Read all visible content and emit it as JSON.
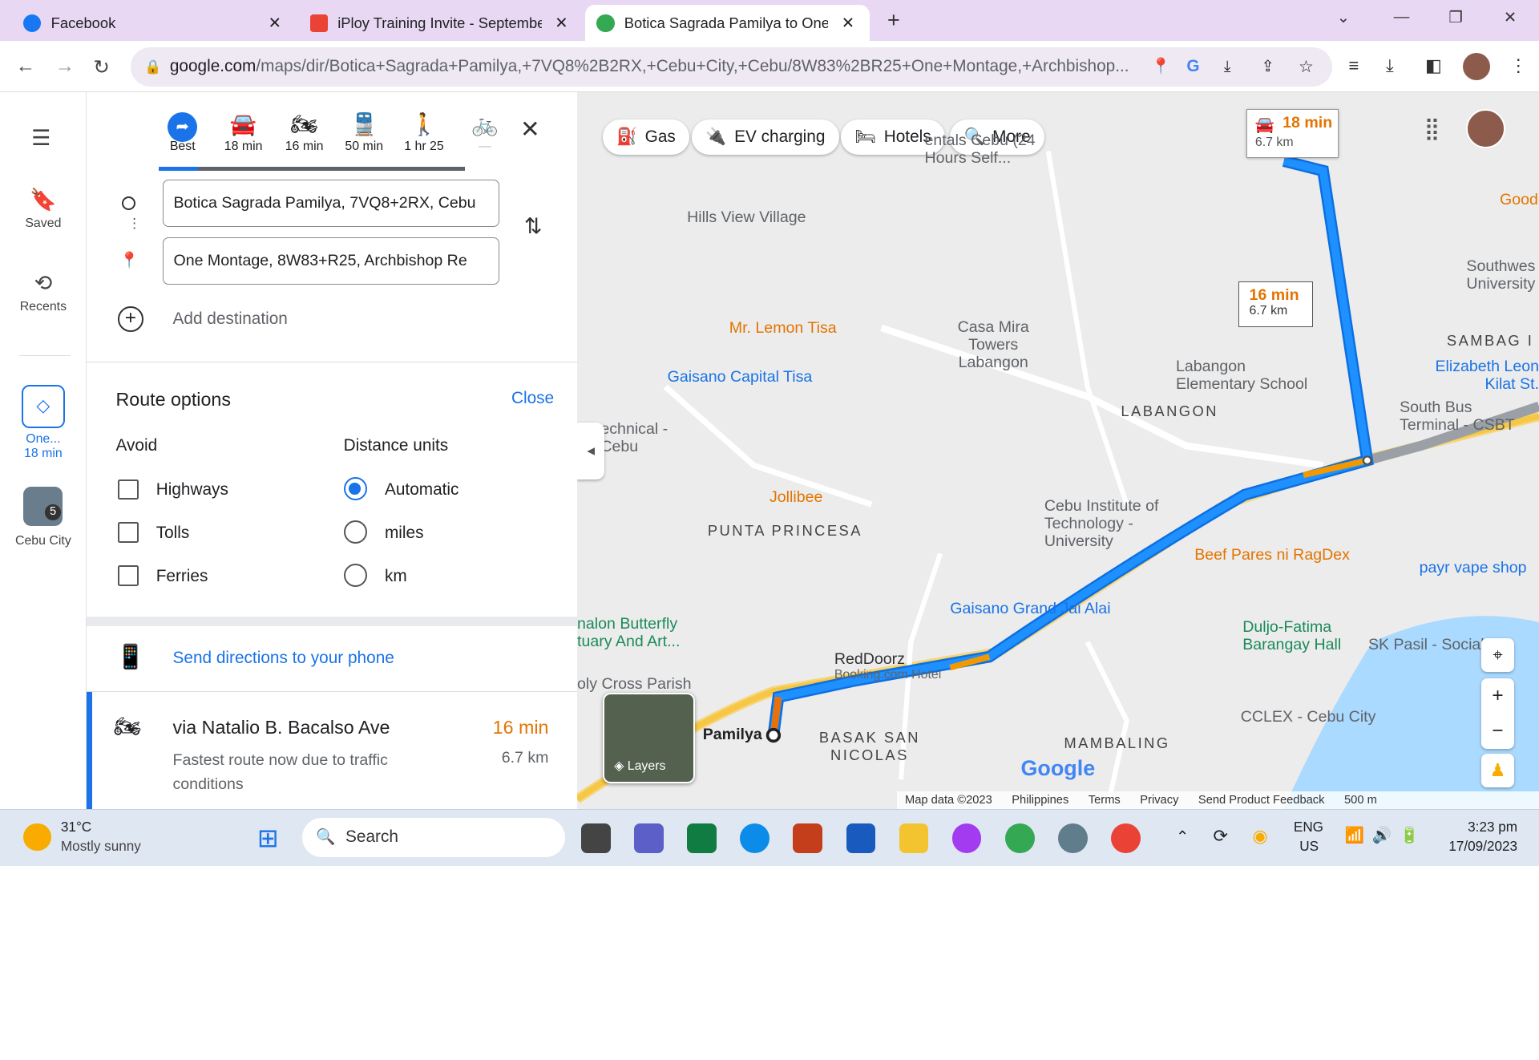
{
  "browser": {
    "tabs": [
      {
        "title": "Facebook",
        "color": "#1877f2"
      },
      {
        "title": "iPloy Training Invite - September",
        "color": "#ea4335"
      },
      {
        "title": "Botica Sagrada Pamilya to One M",
        "color": "#34a853"
      }
    ],
    "url_main": "google.com",
    "url_path": "/maps/dir/Botica+Sagrada+Pamilya,+7VQ8%2B2RX,+Cebu+City,+Cebu/8W83%2BR25+One+Montage,+Archbishop..."
  },
  "rail": {
    "saved": "Saved",
    "recents": "Recents",
    "recent_route_label": "One...",
    "recent_route_time": "18 min",
    "city_label": "Cebu City",
    "city_badge": "5"
  },
  "modes": [
    {
      "label": "Best",
      "icon": "diamond-route-icon"
    },
    {
      "label": "18 min",
      "icon": "car-icon"
    },
    {
      "label": "16 min",
      "icon": "motorcycle-icon"
    },
    {
      "label": "50 min",
      "icon": "train-icon"
    },
    {
      "label": "1 hr 25",
      "icon": "walk-icon"
    },
    {
      "label": "—",
      "icon": "bicycle-icon"
    }
  ],
  "directions": {
    "origin": "Botica Sagrada Pamilya, 7VQ8+2RX, Cebu",
    "destination": "One Montage, 8W83+R25, Archbishop Re",
    "add_destination": "Add destination"
  },
  "route_options": {
    "title": "Route options",
    "close": "Close",
    "avoid_title": "Avoid",
    "avoid": [
      "Highways",
      "Tolls",
      "Ferries"
    ],
    "units_title": "Distance units",
    "units": [
      "Automatic",
      "miles",
      "km"
    ],
    "units_selected": "Automatic"
  },
  "send": "Send directions to your phone",
  "route": {
    "via": "via Natalio B. Bacalso Ave",
    "time": "16 min",
    "desc": "Fastest route now due to traffic conditions",
    "dist": "6.7 km"
  },
  "map": {
    "chips": [
      "Gas",
      "EV charging",
      "Hotels",
      "More"
    ],
    "callout1": {
      "time": "18 min",
      "dist": "6.7 km"
    },
    "callout2": {
      "time": "16 min",
      "dist": "6.7 km"
    },
    "labels": {
      "hills": "Hills View Village",
      "lemon": "Mr. Lemon Tisa",
      "casa": "Casa Mira Towers Labangon",
      "gaisano_tisa": "Gaisano Capital Tisa",
      "labangon_school": "Labangon Elementary School",
      "labangon": "LABANGON",
      "jollibee": "Jollibee",
      "punta": "PUNTA PRINCESA",
      "cit": "Cebu Institute of Technology - University",
      "beef": "Beef Pares ni RagDex",
      "payr": "payr vape shop",
      "gaisano_grand": "Gaisano Grand Jai Alai",
      "duljo": "Duljo-Fatima Barangay Hall",
      "sk": "SK Pasil - Social",
      "reddoorz": "RedDoorz",
      "reddoorz_sub": "Booking.com Hotel",
      "butterfly": "nalon Butterfly tuary And Art...",
      "cross": "oly Cross Parish",
      "pamilya": "Pamilya",
      "basak": "BASAK SAN NICOLAS",
      "mambaling": "MAMBALING",
      "cclex": "CCLEX - Cebu City",
      "sambag": "SAMBAG I",
      "southwest": "Southwes University",
      "elizabeth": "Elizabeth Leon Kilat St.",
      "southbus": "South Bus Terminal - CSBT",
      "goodc": "Good C",
      "rentals": "entals Cebu (24 Hours Self...",
      "technical": "echnical - Cebu",
      "layers": "Layers"
    },
    "footer": [
      "Map data ©2023",
      "Philippines",
      "Terms",
      "Privacy",
      "Send Product Feedback",
      "500 m"
    ]
  },
  "taskbar": {
    "temp": "31°C",
    "weather": "Mostly sunny",
    "search": "Search",
    "lang1": "ENG",
    "lang2": "US",
    "time": "3:23 pm",
    "date": "17/09/2023"
  }
}
